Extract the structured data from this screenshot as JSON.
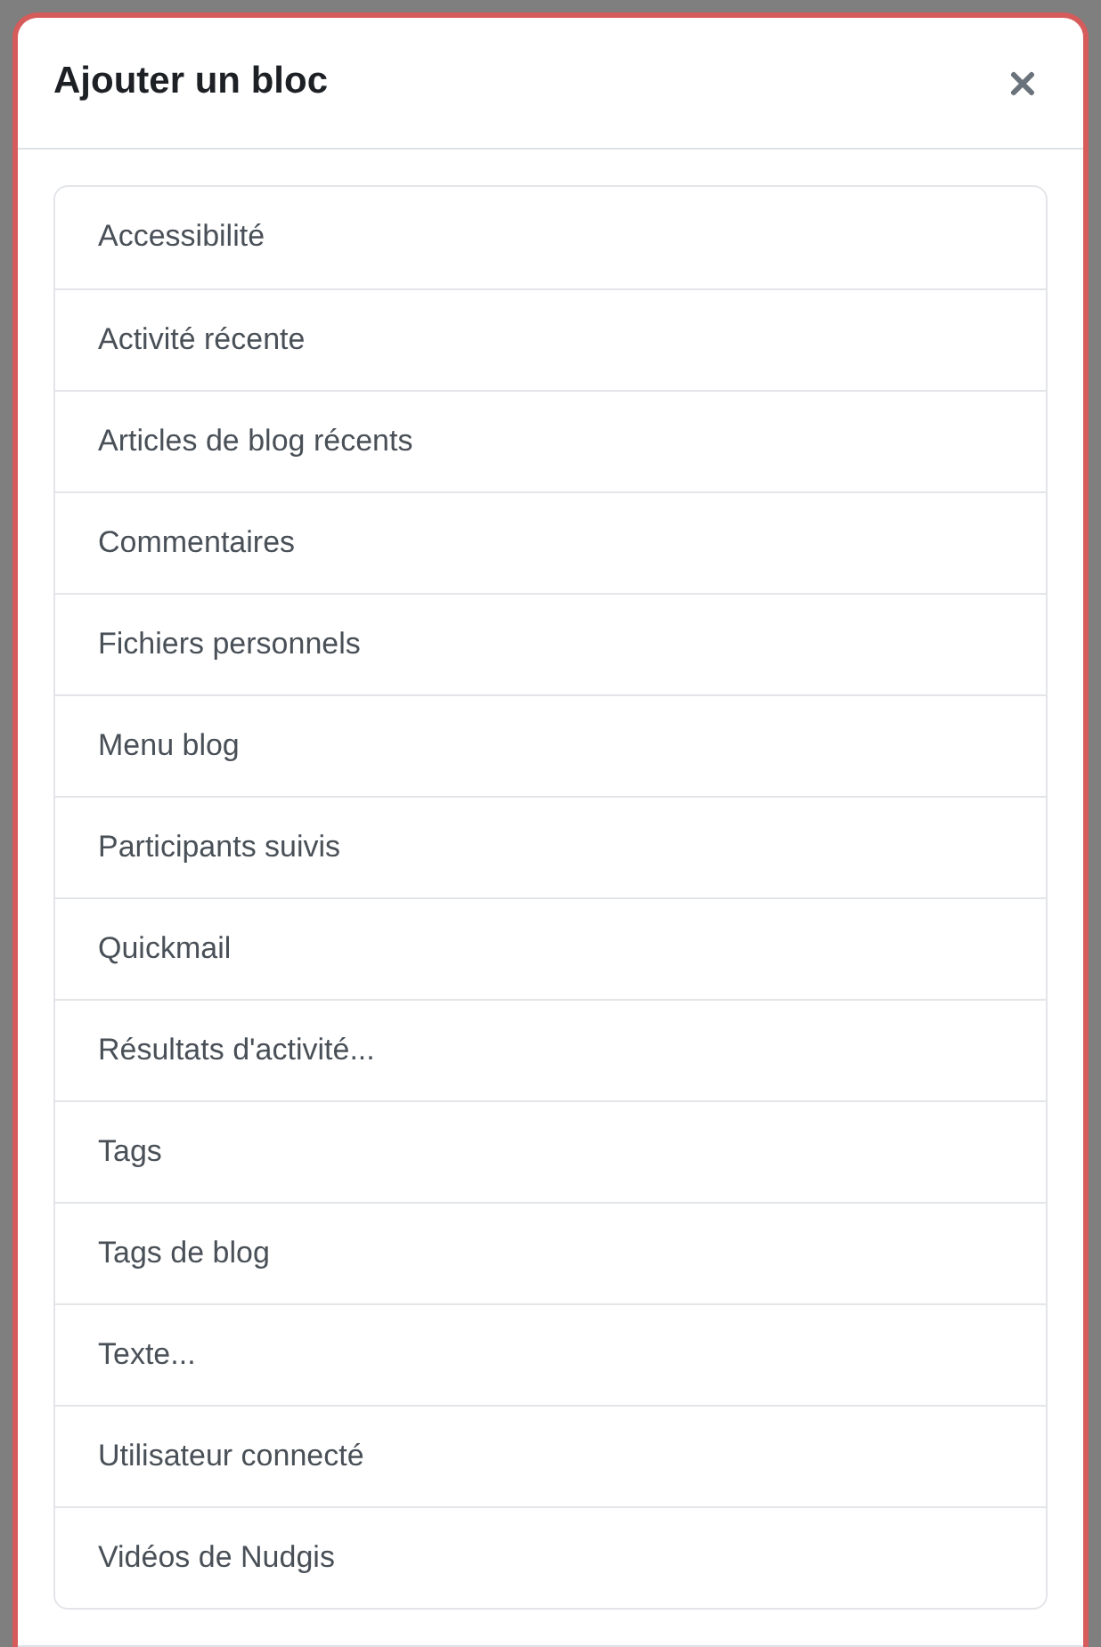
{
  "dialog": {
    "title": "Ajouter un bloc",
    "close": {
      "kind": "icon"
    }
  },
  "blocks": [
    {
      "label": "Accessibilité"
    },
    {
      "label": "Activité récente"
    },
    {
      "label": "Articles de blog récents"
    },
    {
      "label": "Commentaires"
    },
    {
      "label": "Fichiers personnels"
    },
    {
      "label": "Menu blog"
    },
    {
      "label": "Participants suivis"
    },
    {
      "label": "Quickmail"
    },
    {
      "label": "Résultats d'activité..."
    },
    {
      "label": "Tags"
    },
    {
      "label": "Tags de blog"
    },
    {
      "label": "Texte..."
    },
    {
      "label": "Utilisateur connecté"
    },
    {
      "label": "Vidéos de Nudgis"
    }
  ]
}
